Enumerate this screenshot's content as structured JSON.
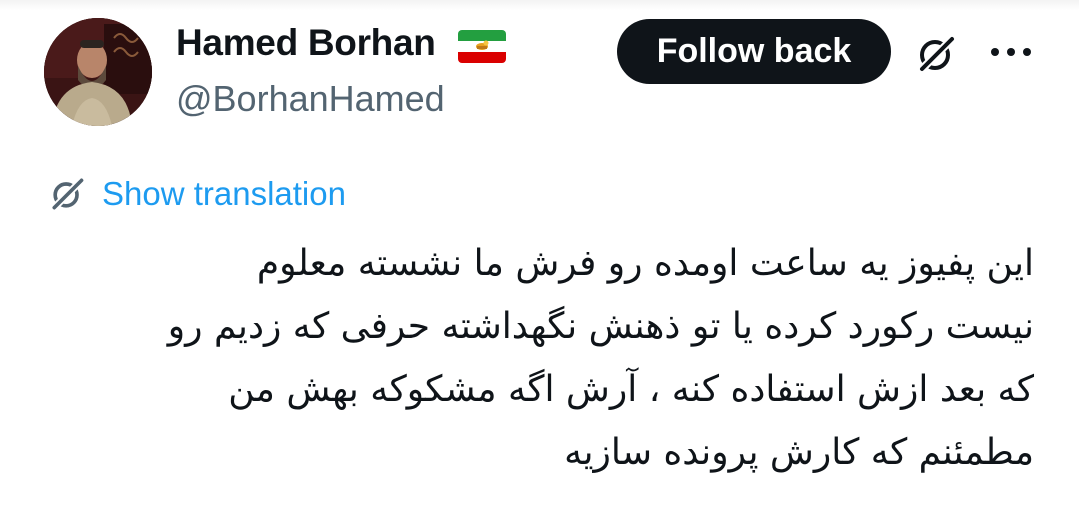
{
  "author": {
    "display_name": "Hamed Borhan",
    "handle": "@BorhanHamed",
    "flag_emoji": "iran-lion-and-sun-flag"
  },
  "actions": {
    "follow_label": "Follow back",
    "grok_icon": "grok-slash-circle-icon",
    "more_icon": "more-horizontal-icon"
  },
  "translation": {
    "label": "Show translation",
    "icon": "grok-slash-circle-icon"
  },
  "tweet": {
    "lines": [
      "این پفیوز یه ساعت اومده رو فرش ما نشسته معلوم",
      "نیست رکورد کرده یا تو ذهنش نگهداشته حرفی که زدیم رو",
      "که بعد ازش استفاده کنه ، آرش اگه مشکوکه بهش من",
      "مطمئنم که کارش پرونده سازیه"
    ]
  },
  "colors": {
    "text_primary": "#0f1419",
    "text_secondary": "#536471",
    "link": "#1d9bf0",
    "button_bg": "#0f1419",
    "button_text": "#ffffff"
  }
}
